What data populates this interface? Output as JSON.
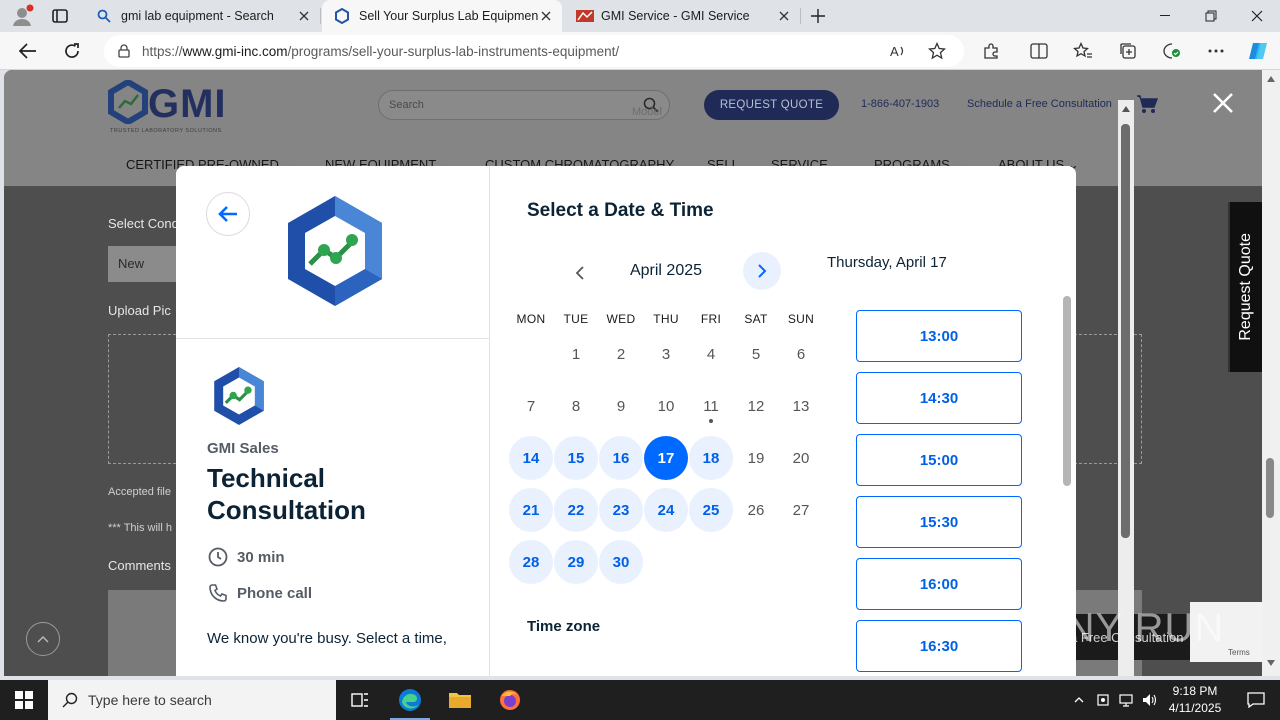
{
  "browser": {
    "tabs": [
      {
        "title": "gmi lab equipment - Search",
        "icon": "search-icon"
      },
      {
        "title": "Sell Your Surplus Lab Equipment",
        "icon": "gmi-hex-icon"
      },
      {
        "title": "GMI Service - GMI Service",
        "icon": "gmi-service-icon"
      }
    ],
    "url_prefix": "https://",
    "url_domain": "www.gmi-inc.com",
    "url_path": "/programs/sell-your-surplus-lab-instruments-equipment/"
  },
  "site": {
    "logo_text": "GMI",
    "logo_tagline": "TRUSTED LABORATORY SOLUTIONS",
    "search_placeholder": "Search",
    "request_quote": "REQUEST QUOTE",
    "phone": "1-866-407-1903",
    "schedule": "Schedule a Free Consultation",
    "nav": [
      "CERTIFIED PRE-OWNED",
      "NEW EQUIPMENT",
      "CUSTOM CHROMATOGRAPHY",
      "SELL",
      "SERVICE",
      "PROGRAMS",
      "ABOUT US"
    ],
    "form": {
      "select_label": "Select Cond",
      "select_value": "New",
      "upload_label": "Upload Pic",
      "accepted": "Accepted file",
      "note": "*** This will h",
      "comments": "Comments",
      "model_ghost": "Model"
    },
    "side_tab": "Request Quote",
    "free_consult": "a Free Consultation",
    "terms": "Terms"
  },
  "modal": {
    "org": "GMI Sales",
    "event_name": "Technical Consultation",
    "duration": "30 min",
    "location": "Phone call",
    "description": "We know you're busy. Select a time,",
    "heading": "Select a Date & Time",
    "month": "April 2025",
    "weekdays": [
      "MON",
      "TUE",
      "WED",
      "THU",
      "FRI",
      "SAT",
      "SUN"
    ],
    "days": [
      {
        "d": "1",
        "state": "off"
      },
      {
        "d": "2",
        "state": "off"
      },
      {
        "d": "3",
        "state": "off"
      },
      {
        "d": "4",
        "state": "off"
      },
      {
        "d": "5",
        "state": "off"
      },
      {
        "d": "6",
        "state": "off"
      },
      {
        "d": "7",
        "state": "off"
      },
      {
        "d": "8",
        "state": "off"
      },
      {
        "d": "9",
        "state": "off"
      },
      {
        "d": "10",
        "state": "off"
      },
      {
        "d": "11",
        "state": "today"
      },
      {
        "d": "12",
        "state": "off"
      },
      {
        "d": "13",
        "state": "off"
      },
      {
        "d": "14",
        "state": "avail"
      },
      {
        "d": "15",
        "state": "avail"
      },
      {
        "d": "16",
        "state": "avail"
      },
      {
        "d": "17",
        "state": "selected"
      },
      {
        "d": "18",
        "state": "avail"
      },
      {
        "d": "19",
        "state": "off"
      },
      {
        "d": "20",
        "state": "off"
      },
      {
        "d": "21",
        "state": "avail"
      },
      {
        "d": "22",
        "state": "avail"
      },
      {
        "d": "23",
        "state": "avail"
      },
      {
        "d": "24",
        "state": "avail"
      },
      {
        "d": "25",
        "state": "avail"
      },
      {
        "d": "26",
        "state": "off"
      },
      {
        "d": "27",
        "state": "off"
      },
      {
        "d": "28",
        "state": "avail"
      },
      {
        "d": "29",
        "state": "avail"
      },
      {
        "d": "30",
        "state": "avail"
      }
    ],
    "first_weekday_index": 1,
    "selected_date": "Thursday, April 17",
    "time_zone_label": "Time zone",
    "slots": [
      "13:00",
      "14:30",
      "15:00",
      "15:30",
      "16:00",
      "16:30"
    ]
  },
  "taskbar": {
    "search_placeholder": "Type here to search",
    "time": "9:18 PM",
    "date": "4/11/2025"
  },
  "watermark": "ANY RUN",
  "colors": {
    "accent": "#0069ff",
    "accent_light": "#e8f1fd",
    "brand_navy": "#1f2a57"
  }
}
